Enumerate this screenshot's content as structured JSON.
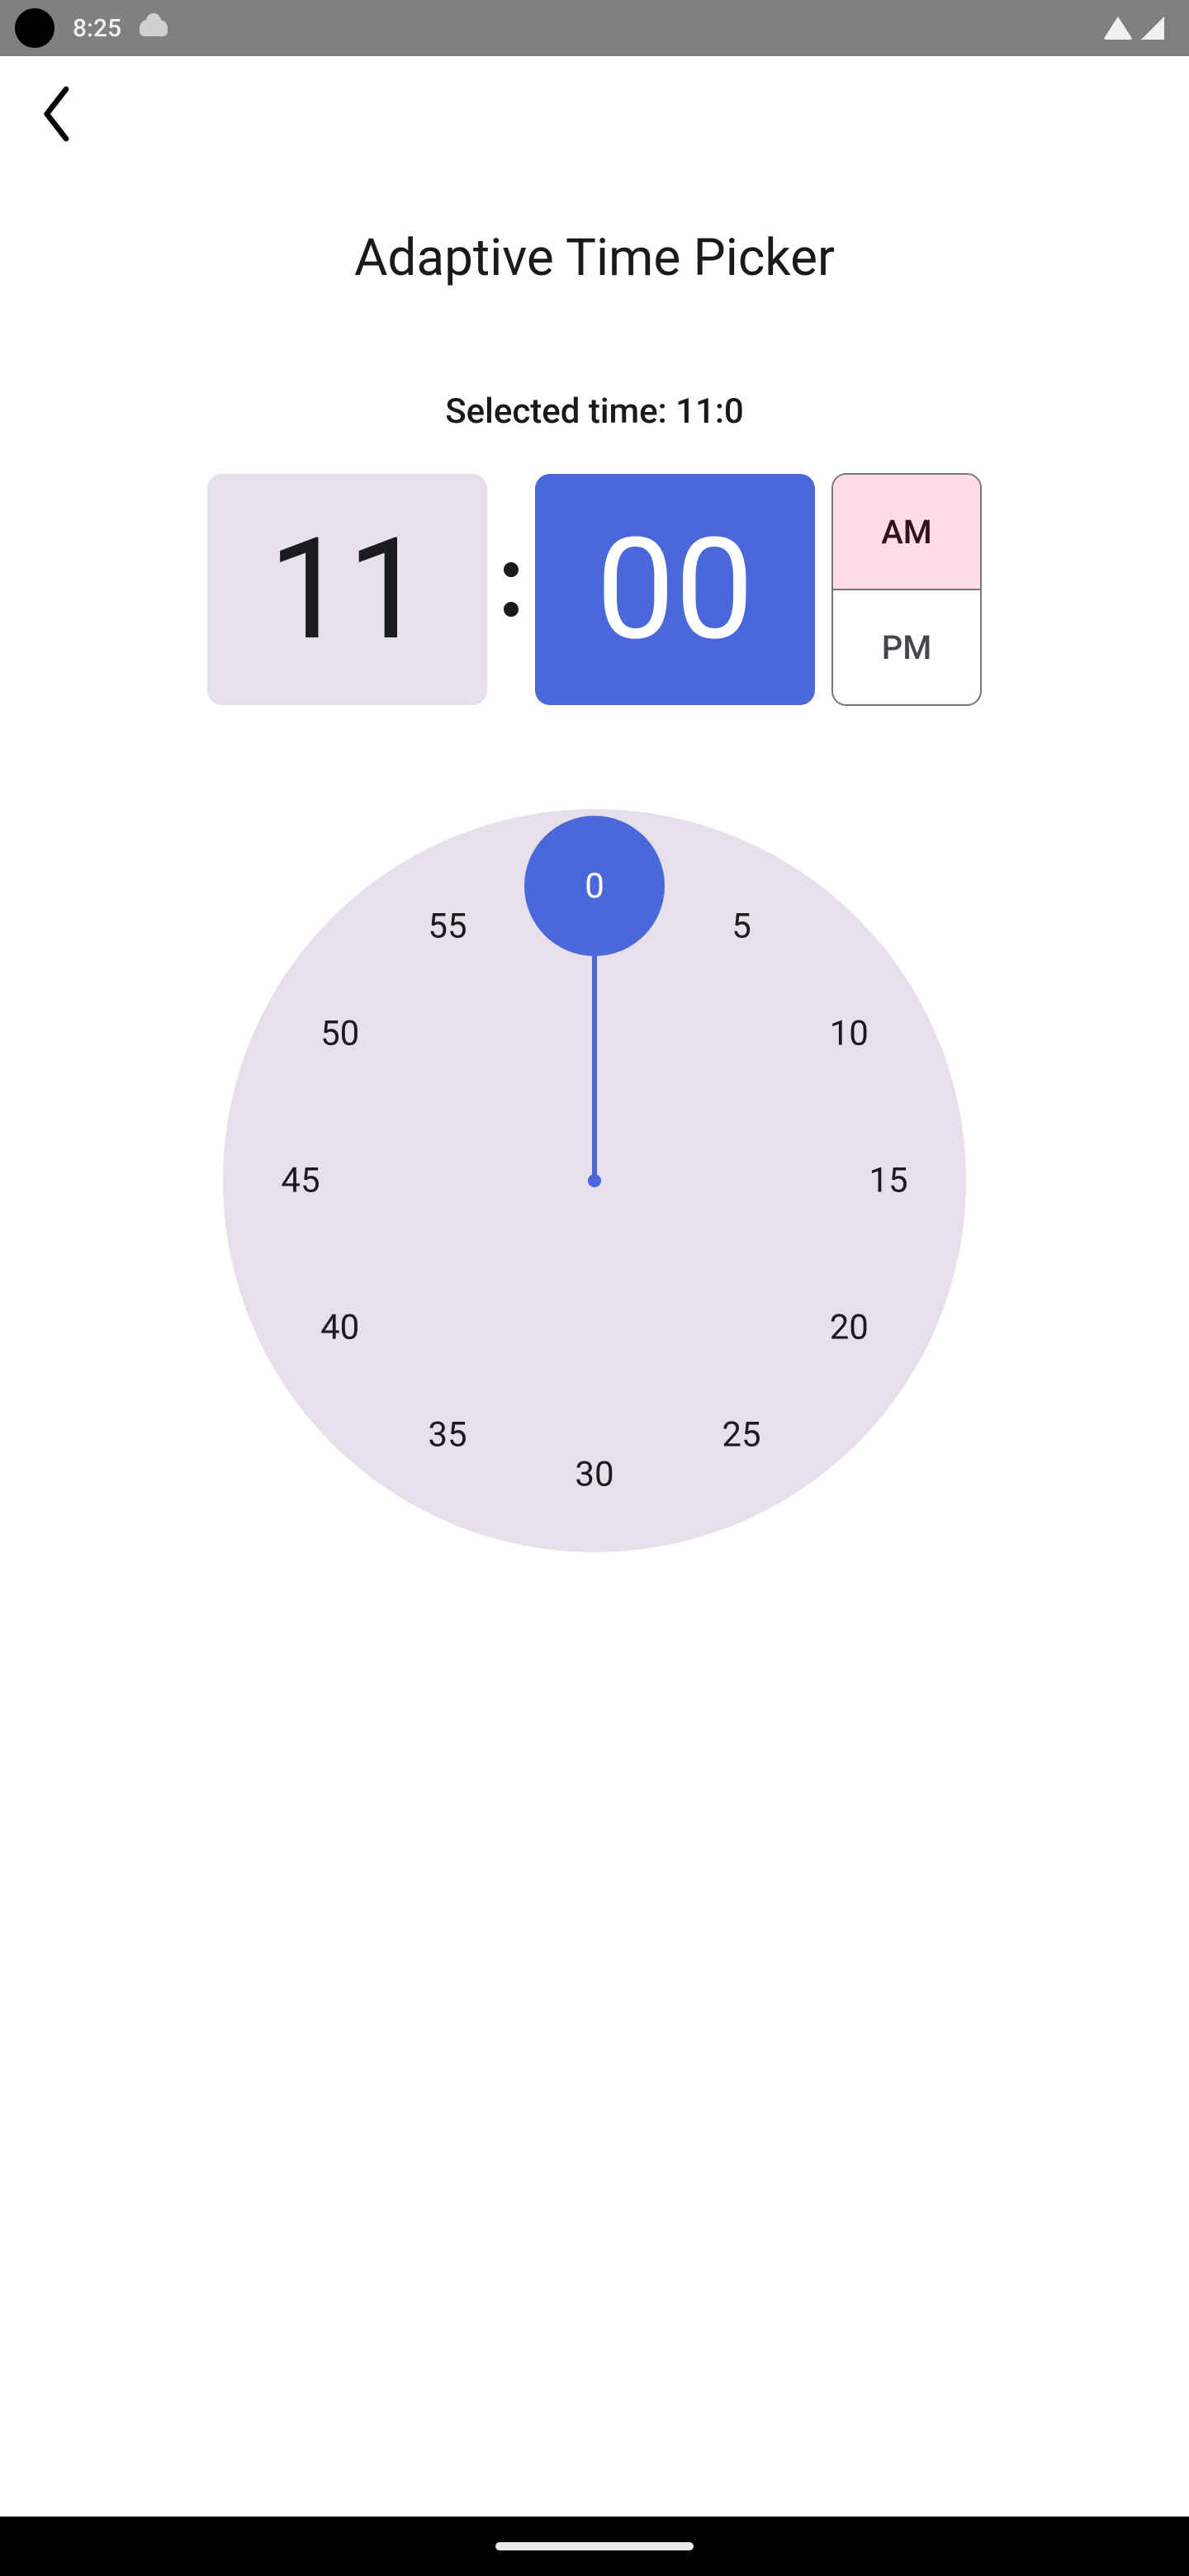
{
  "status": {
    "time": "8:25"
  },
  "header": {
    "title": "Adaptive Time Picker"
  },
  "selected": {
    "prefix": "Selected time: ",
    "hour": 11,
    "minute": 0,
    "display": "Selected time: 11:0"
  },
  "digital": {
    "hour": "11",
    "minute": "00",
    "am_label": "AM",
    "pm_label": "PM",
    "period": "AM"
  },
  "clock": {
    "mode": "minutes",
    "selected_value": 0,
    "ticks": [
      {
        "label": "0",
        "angle": 0,
        "selected": true
      },
      {
        "label": "5",
        "angle": 30,
        "selected": false
      },
      {
        "label": "10",
        "angle": 60,
        "selected": false
      },
      {
        "label": "15",
        "angle": 90,
        "selected": false
      },
      {
        "label": "20",
        "angle": 120,
        "selected": false
      },
      {
        "label": "25",
        "angle": 150,
        "selected": false
      },
      {
        "label": "30",
        "angle": 180,
        "selected": false
      },
      {
        "label": "35",
        "angle": 210,
        "selected": false
      },
      {
        "label": "40",
        "angle": 240,
        "selected": false
      },
      {
        "label": "45",
        "angle": 270,
        "selected": false
      },
      {
        "label": "50",
        "angle": 300,
        "selected": false
      },
      {
        "label": "55",
        "angle": 330,
        "selected": false
      }
    ]
  },
  "colors": {
    "accent": "#4a68da",
    "surface_variant": "#e7e0ec",
    "am_selected_bg": "#fcdde7"
  }
}
